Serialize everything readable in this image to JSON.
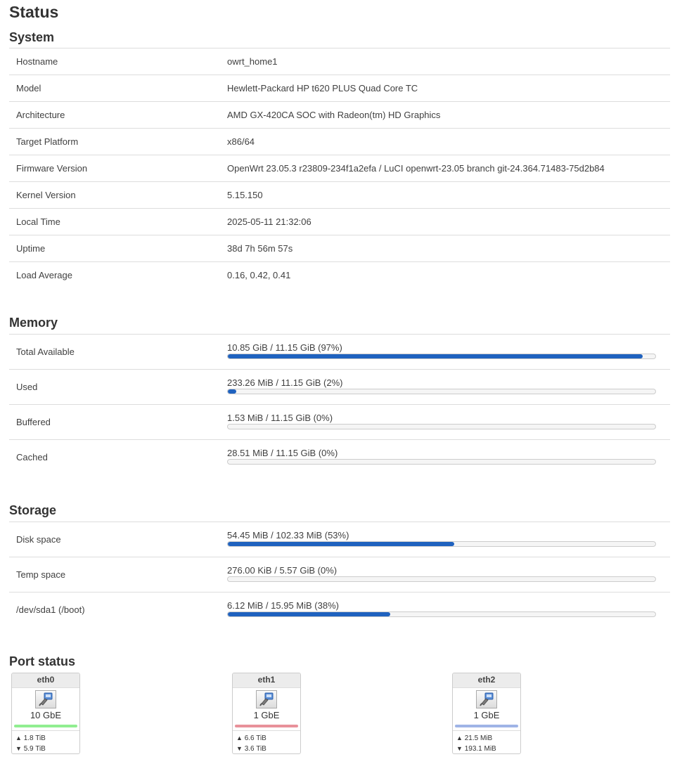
{
  "page": {
    "title": "Status"
  },
  "system": {
    "title": "System",
    "rows": [
      {
        "key": "Hostname",
        "value": "owrt_home1"
      },
      {
        "key": "Model",
        "value": "Hewlett-Packard HP t620 PLUS Quad Core TC"
      },
      {
        "key": "Architecture",
        "value": "AMD GX-420CA SOC with Radeon(tm) HD Graphics"
      },
      {
        "key": "Target Platform",
        "value": "x86/64"
      },
      {
        "key": "Firmware Version",
        "value": "OpenWrt 23.05.3 r23809-234f1a2efa / LuCI openwrt-23.05 branch git-24.364.71483-75d2b84"
      },
      {
        "key": "Kernel Version",
        "value": "5.15.150"
      },
      {
        "key": "Local Time",
        "value": "2025-05-11 21:32:06"
      },
      {
        "key": "Uptime",
        "value": "38d 7h 56m 57s"
      },
      {
        "key": "Load Average",
        "value": "0.16, 0.42, 0.41"
      }
    ]
  },
  "memory": {
    "title": "Memory",
    "rows": [
      {
        "key": "Total Available",
        "value": "10.85 GiB / 11.15 GiB (97%)",
        "percent": 97
      },
      {
        "key": "Used",
        "value": "233.26 MiB / 11.15 GiB (2%)",
        "percent": 2
      },
      {
        "key": "Buffered",
        "value": "1.53 MiB / 11.15 GiB (0%)",
        "percent": 0
      },
      {
        "key": "Cached",
        "value": "28.51 MiB / 11.15 GiB (0%)",
        "percent": 0
      }
    ]
  },
  "storage": {
    "title": "Storage",
    "rows": [
      {
        "key": "Disk space",
        "value": "54.45 MiB / 102.33 MiB (53%)",
        "percent": 53
      },
      {
        "key": "Temp space",
        "value": "276.00 KiB / 5.57 GiB (0%)",
        "percent": 0
      },
      {
        "key": "/dev/sda1 (/boot)",
        "value": "6.12 MiB / 15.95 MiB (38%)",
        "percent": 38
      }
    ]
  },
  "ports": {
    "title": "Port status",
    "items": [
      {
        "name": "eth0",
        "speed": "10 GbE",
        "status_color": "#90ee90",
        "tx": "1.8 TiB",
        "rx": "5.9 TiB",
        "icon": "ethernet-port-icon"
      },
      {
        "name": "eth1",
        "speed": "1 GbE",
        "status_color": "#e8919a",
        "tx": "6.6 TiB",
        "rx": "3.6 TiB",
        "icon": "ethernet-port-icon"
      },
      {
        "name": "eth2",
        "speed": "1 GbE",
        "status_color": "#9fb4e6",
        "tx": "21.5 MiB",
        "rx": "193.1 MiB",
        "icon": "ethernet-port-icon"
      }
    ]
  },
  "colors": {
    "bar_fill": "#1f62bf",
    "bar_track": "#f5f5f5"
  }
}
